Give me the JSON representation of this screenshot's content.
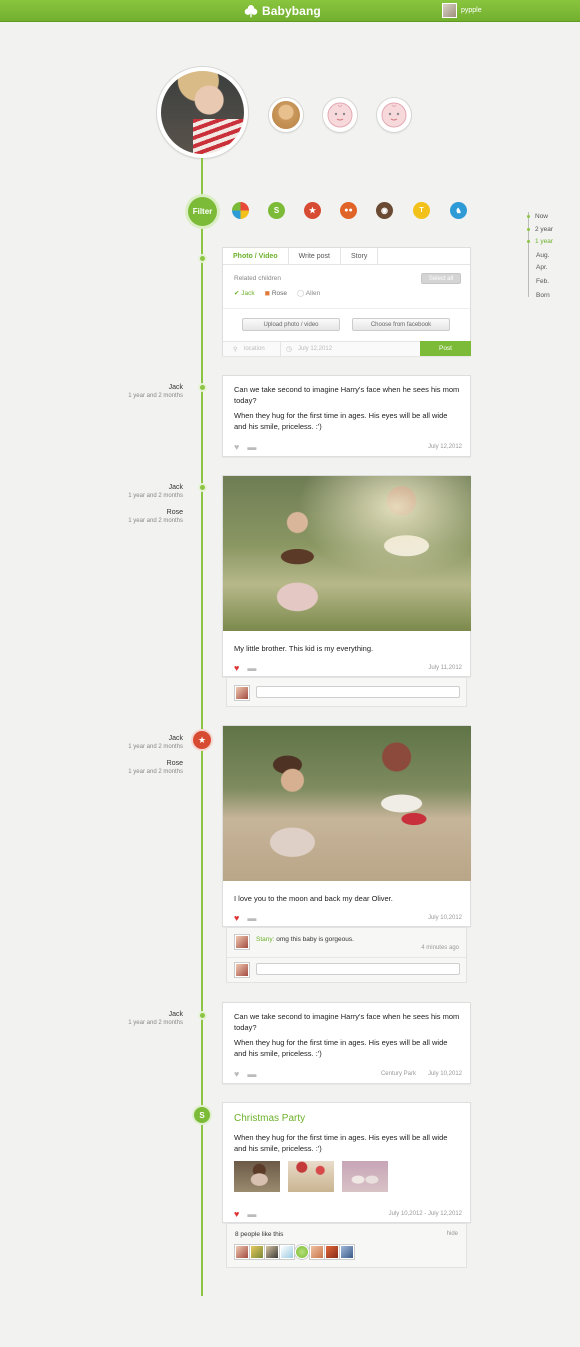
{
  "header": {
    "brand": "Babybang",
    "username": "pypple",
    "brand_color": "#7cbb37"
  },
  "filter": {
    "label": "Filter",
    "icons": [
      {
        "name": "pie-chart-icon",
        "color": "#f0a030"
      },
      {
        "name": "s-icon",
        "color": "#7cbb37",
        "text": "S"
      },
      {
        "name": "star-icon",
        "color": "#d84b33",
        "text": "★"
      },
      {
        "name": "people-icon",
        "color": "#e06427",
        "text": "👥"
      },
      {
        "name": "camera-icon",
        "color": "#6b4a33",
        "text": "◉"
      },
      {
        "name": "shirt-icon",
        "color": "#f2c21b",
        "text": "👕"
      },
      {
        "name": "rocking-horse-icon",
        "color": "#2f9bd6",
        "text": "🐴"
      }
    ]
  },
  "mini_timeline": [
    "Now",
    "2 year",
    "1 year",
    "Aug.",
    "Apr.",
    "Feb.",
    "Born"
  ],
  "composer": {
    "tabs": [
      "Photo / Video",
      "Write post",
      "Story"
    ],
    "related_label": "Related children",
    "select_all": "Select all",
    "children": [
      "Jack",
      "Rose",
      "Allen"
    ],
    "upload_button": "Upload photo / video",
    "facebook_button": "Choose from facebook",
    "location_placeholder": "location",
    "date": "July 12,2012",
    "post_button": "Post"
  },
  "posts": [
    {
      "names": [
        {
          "name": "Jack",
          "age": "1 year and 2 months"
        }
      ],
      "text1": "Can we take second to imagine Harry's face when he sees his mom today?",
      "text2": "When they hug for the first time in ages. His eyes will be all wide and his smile, priceless. :')",
      "date": "July 12,2012"
    },
    {
      "names": [
        {
          "name": "Jack",
          "age": "1 year and 2 months"
        },
        {
          "name": "Rose",
          "age": "1 year and 2 months"
        }
      ],
      "caption": "My little brother. This kid is my everything.",
      "date": "July 11,2012"
    },
    {
      "names": [
        {
          "name": "Jack",
          "age": "1 year and 2 months"
        },
        {
          "name": "Rose",
          "age": "1 year and 2 months"
        }
      ],
      "caption": "I love you to the moon and back my dear Oliver.",
      "date": "July 10,2012",
      "comment": {
        "author": "Stany:",
        "text": "omg this baby is gorgeous.",
        "time": "4 minutes ago"
      }
    },
    {
      "names": [
        {
          "name": "Jack",
          "age": "1 year and 2 months"
        }
      ],
      "text1": "Can we take second to imagine Harry's face when he sees his mom today?",
      "text2": "When they hug for the first time in ages. His eyes will be all wide and his smile, priceless. :')",
      "location": "Century Park",
      "date": "July 10,2012"
    },
    {
      "title": "Christmas Party",
      "text": "When they hug for the first time in ages. His eyes will be all wide and his smile, priceless. :')",
      "date": "July 10,2012 - July 12,2012",
      "likes": "8 people like this",
      "hide": "hide"
    }
  ]
}
